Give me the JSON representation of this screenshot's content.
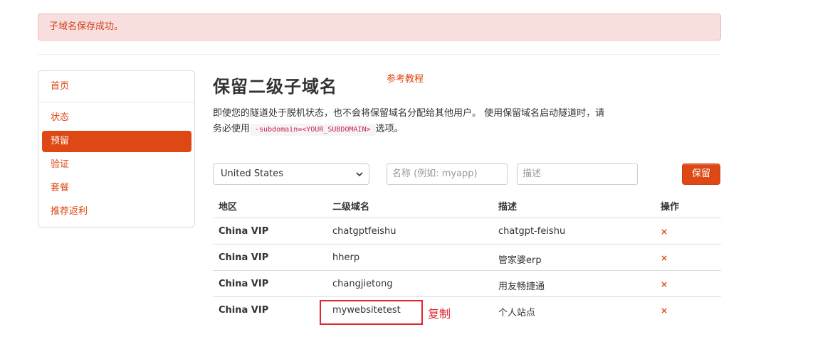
{
  "alert": {
    "message": "子域名保存成功。"
  },
  "sidebar": {
    "items": [
      {
        "label": "首页"
      },
      {
        "label": "状态"
      },
      {
        "label": "预留",
        "active": true
      },
      {
        "label": "验证"
      },
      {
        "label": "套餐"
      },
      {
        "label": "推荐返利"
      }
    ]
  },
  "main": {
    "title": "保留二级子域名",
    "ref_link": "参考教程",
    "description_before": "即使您的隧道处于脱机状态，也不会将保留域名分配给其他用户。 使用保留域名启动隧道时，请务必使用",
    "description_code": "-subdomain=<YOUR_SUBDOMAIN>",
    "description_after": "选项。"
  },
  "form": {
    "region_selected": "United States",
    "name_placeholder": "名称 (例如: myapp)",
    "desc_placeholder": "描述",
    "submit_label": "保留"
  },
  "table": {
    "headers": [
      "地区",
      "二级域名",
      "描述",
      "操作"
    ],
    "rows": [
      {
        "region": "China VIP",
        "subdomain": "chatgptfeishu",
        "desc": "chatgpt-feishu",
        "action": "×"
      },
      {
        "region": "China VIP",
        "subdomain": "hherp",
        "desc": "管家婆erp",
        "action": "×"
      },
      {
        "region": "China VIP",
        "subdomain": "changjietong",
        "desc": "用友畅捷通",
        "action": "×"
      },
      {
        "region": "China VIP",
        "subdomain": "mywebsitetest",
        "desc": "个人站点",
        "action": "×"
      }
    ]
  },
  "annotation": {
    "copy_label": "复制"
  },
  "colors": {
    "accent": "#dd4814",
    "alert_bg": "#f9dede",
    "annotation": "#e0262a"
  }
}
